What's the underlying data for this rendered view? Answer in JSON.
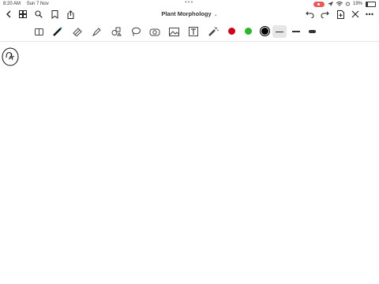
{
  "status": {
    "time": "8:20 AM",
    "date": "Sun 7 Nov",
    "battery": "19%"
  },
  "header": {
    "title": "Plant Morphology"
  },
  "icons": {
    "back": "chevron-left-icon",
    "grid": "grid-icon",
    "search": "search-icon",
    "bookmark": "bookmark-icon",
    "share": "share-icon",
    "undo": "undo-icon",
    "redo": "redo-icon",
    "add_page": "add-page-icon",
    "close": "close-icon",
    "more": "more-icon"
  },
  "tools": [
    "reader-mode",
    "pen",
    "eraser",
    "highlighter",
    "shapes",
    "lasso",
    "camera",
    "image",
    "text",
    "laser-pointer"
  ],
  "colors": [
    "#d0021b",
    "#2cb52c",
    "#000000"
  ],
  "pen_sizes": [
    "fine",
    "medium",
    "thick"
  ]
}
